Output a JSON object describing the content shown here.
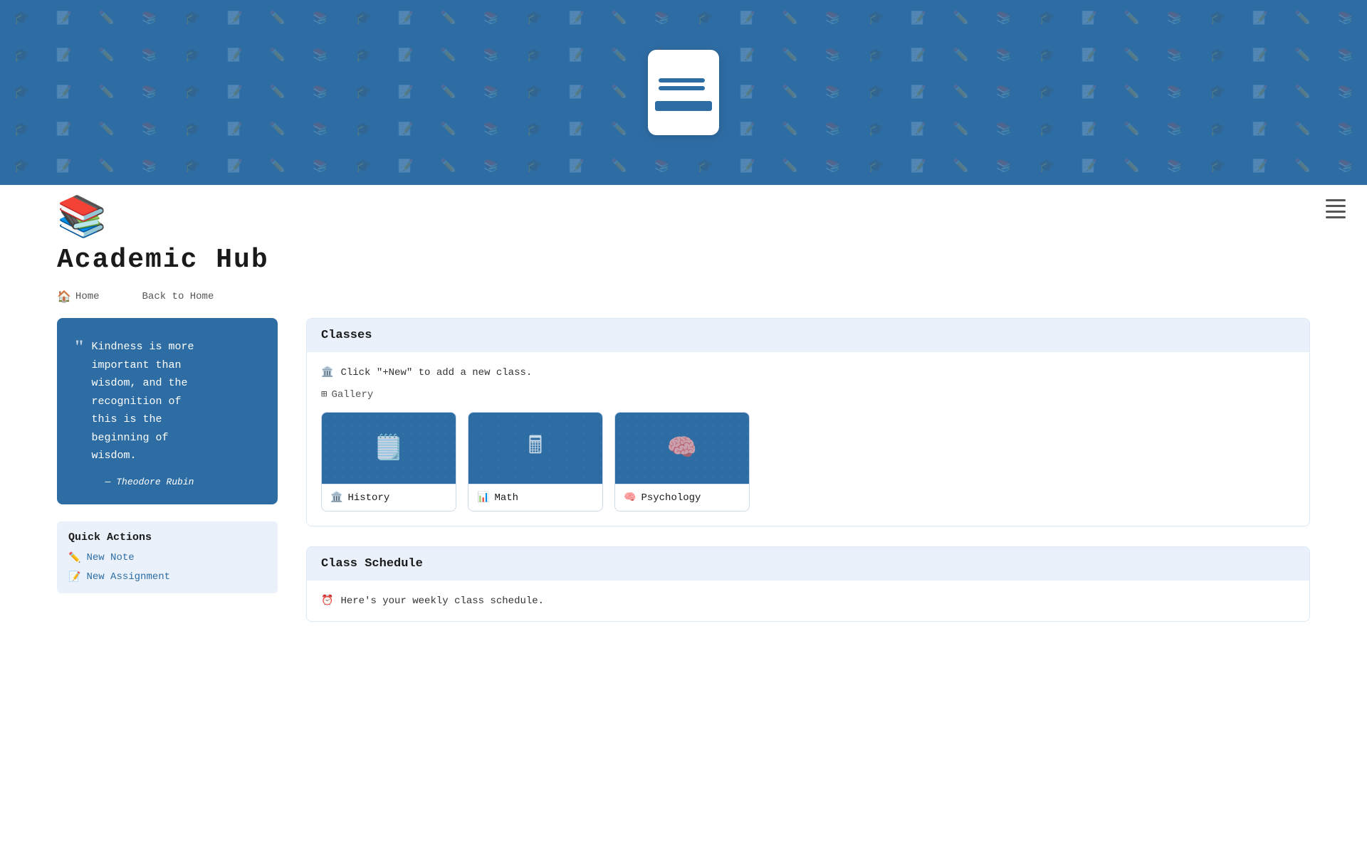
{
  "header": {
    "logo_alt": "Academic Hub Logo"
  },
  "title_area": {
    "emoji": "📚",
    "title": "Academic  Hub"
  },
  "breadcrumb": {
    "home_label": "Home",
    "back_label": "Back to Home"
  },
  "quote": {
    "text": "Kindness is more\nimportant than\nwisdom, and the\nrecognition of\nthis is the\nbeginning of\nwisdom.",
    "author": "— Theodore Rubin"
  },
  "quick_actions": {
    "title": "Quick Actions",
    "items": [
      {
        "icon": "✏️",
        "label": "New   Note"
      },
      {
        "icon": "📝",
        "label": "New Assignment"
      }
    ]
  },
  "classes_section": {
    "header": "Classes",
    "info_text": "Click \"+New\" to add a new class.",
    "gallery_label": "Gallery",
    "cards": [
      {
        "label": "History",
        "emoji": "🏛️"
      },
      {
        "label": "Math",
        "emoji": "📊"
      },
      {
        "label": "Psychology",
        "emoji": "🧠"
      }
    ]
  },
  "schedule_section": {
    "header": "Class Schedule",
    "info_text": "Here's your weekly class schedule."
  },
  "pattern": {
    "symbols": [
      "🎓",
      "📝",
      "✏️",
      "📚",
      "🎓",
      "📝",
      "✏️",
      "📚"
    ]
  }
}
